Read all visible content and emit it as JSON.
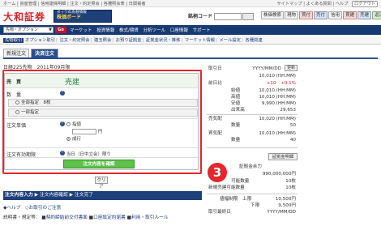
{
  "toplinks": {
    "left": "ホーム | 資産管理 | 信用建株明細 | 注文・約定照会 | 各種照会表 | 日興電者",
    "right": "サイトマップ | よくある質問 | ヘルプ",
    "logout": "ログアウト"
  },
  "header": {
    "logo": "大和証券",
    "ad_line1": "ダイワの為替情報",
    "ad_line2": "株価ボード",
    "stock_code_label": "銘柄コード",
    "stock_code_value": "",
    "trade_buttons": [
      "株価検索",
      "現物",
      "買付",
      "売付",
      "信用",
      "買建",
      "売建",
      "返済",
      "現引"
    ]
  },
  "mainnav": {
    "select": "先物・オプション",
    "go": "Go",
    "items": [
      "マーケット",
      "投資情報",
      "株式/期貨",
      "分析ツール",
      "口座情報",
      "サポート"
    ]
  },
  "subnav": {
    "items": [
      "先物取引",
      "オプション取引",
      "注文・約定照会",
      "建玉照会",
      "お預り証拠金",
      "証拠金状況・推移",
      "マーケット情報",
      "メール設定",
      "各種関連"
    ]
  },
  "tabs": [
    "新規注文",
    "決済注文"
  ],
  "title": "日経225先物　2011年09月限",
  "form": {
    "side_label": "売　買",
    "side_value": "売建",
    "qty_label": "数　量",
    "qty_opt1": "全部指定　8枚",
    "qty_opt2": "一部指定",
    "price_label": "注文単価",
    "price_opt1": "指値",
    "price_unit": "円",
    "price_opt2": "成行",
    "expiry_label": "注文有効期限",
    "expiry_value": "当日（日中立会）限り",
    "confirm": "注文内容を確認"
  },
  "clear": "クリア",
  "stepbar": {
    "step1": "注文内容入力",
    "step2": "注文内容確認",
    "step3": "注文完了"
  },
  "helplinks": [
    "ヘルプ",
    "お取引のご注意"
  ],
  "explain": {
    "label": "説明書・規定等：",
    "links": [
      "契約締結前交付書面",
      "口座設定約諾書",
      "利用・取引ルール"
    ]
  },
  "rightpanel": {
    "rows": [
      {
        "k": "取引日",
        "v": "YYYY/MM/DD"
      },
      {
        "k": "",
        "v": "10,010 (HH:MM)"
      },
      {
        "k": "前日比",
        "v": "+10　+0.1%"
      },
      {
        "k": "始値",
        "v": "10,010 (HH:MM)"
      },
      {
        "k": "高値",
        "v": "10,010 (HH:MM)"
      },
      {
        "k": "安値",
        "v": "9,990 (HH:MM)"
      },
      {
        "k": "出来高",
        "v": "29,653"
      },
      {
        "k": "売気配",
        "v": "10,020 (HH:MM)"
      },
      {
        "k": "数量",
        "v": "50"
      },
      {
        "k": "買気配",
        "v": "10,010 (HH:MM)"
      },
      {
        "k": "数量",
        "v": "40"
      }
    ],
    "refresh": "更新",
    "detail": "証拠金明細",
    "margin_rows": [
      {
        "k": "証拠金余力",
        "v": ""
      },
      {
        "k": "",
        "v": "990,000,000円"
      },
      {
        "k": "可能数量",
        "v": "10枚"
      },
      {
        "k": "新規売建可能数量",
        "v": "10枚"
      }
    ],
    "limit_rows": [
      {
        "k": "値幅制限　上限",
        "v": "10,500円"
      },
      {
        "k": "下限",
        "v": "9,500円"
      },
      {
        "k": "取引最終日",
        "v": "YYYY/MM/DD"
      }
    ]
  },
  "annotation": "3"
}
